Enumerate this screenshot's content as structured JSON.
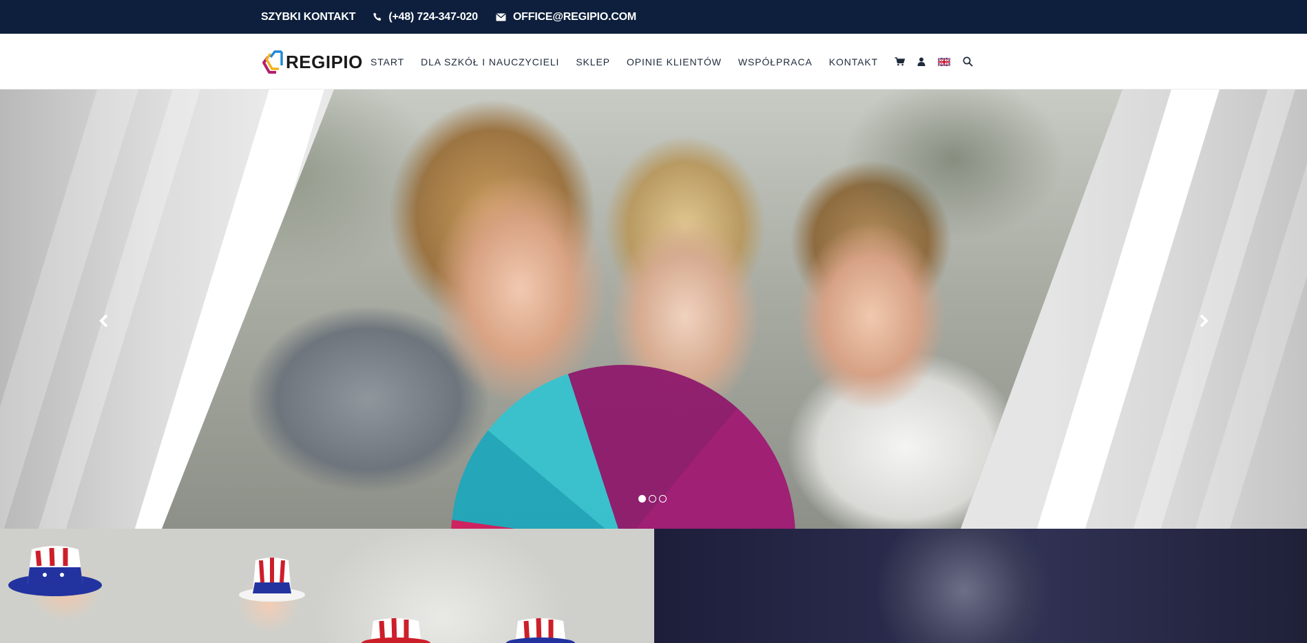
{
  "topbar": {
    "quick_contact": "SZYBKI KONTAKT",
    "phone": "(+48) 724-347-020",
    "email": "OFFICE@REGIPIO.COM"
  },
  "brand": {
    "name": "REGIPIO"
  },
  "nav": {
    "items": [
      {
        "label": "START"
      },
      {
        "label": "DLA SZKÓŁ I NAUCZYCIELI"
      },
      {
        "label": "SKLEP"
      },
      {
        "label": "OPINIE KLIENTÓW"
      },
      {
        "label": "WSPÓŁPRACA"
      },
      {
        "label": "KONTAKT"
      }
    ],
    "icons": [
      "cart-icon",
      "user-icon",
      "uk-flag-icon",
      "search-icon"
    ]
  },
  "hero": {
    "slides_total": 3,
    "active_slide": 1
  },
  "colors": {
    "topbar_bg": "#0d1f3c",
    "nav_text": "#1e2a3a",
    "logo_blue": "#1e88d6",
    "logo_magenta": "#b21f6a",
    "logo_yellow": "#f2b11c"
  }
}
